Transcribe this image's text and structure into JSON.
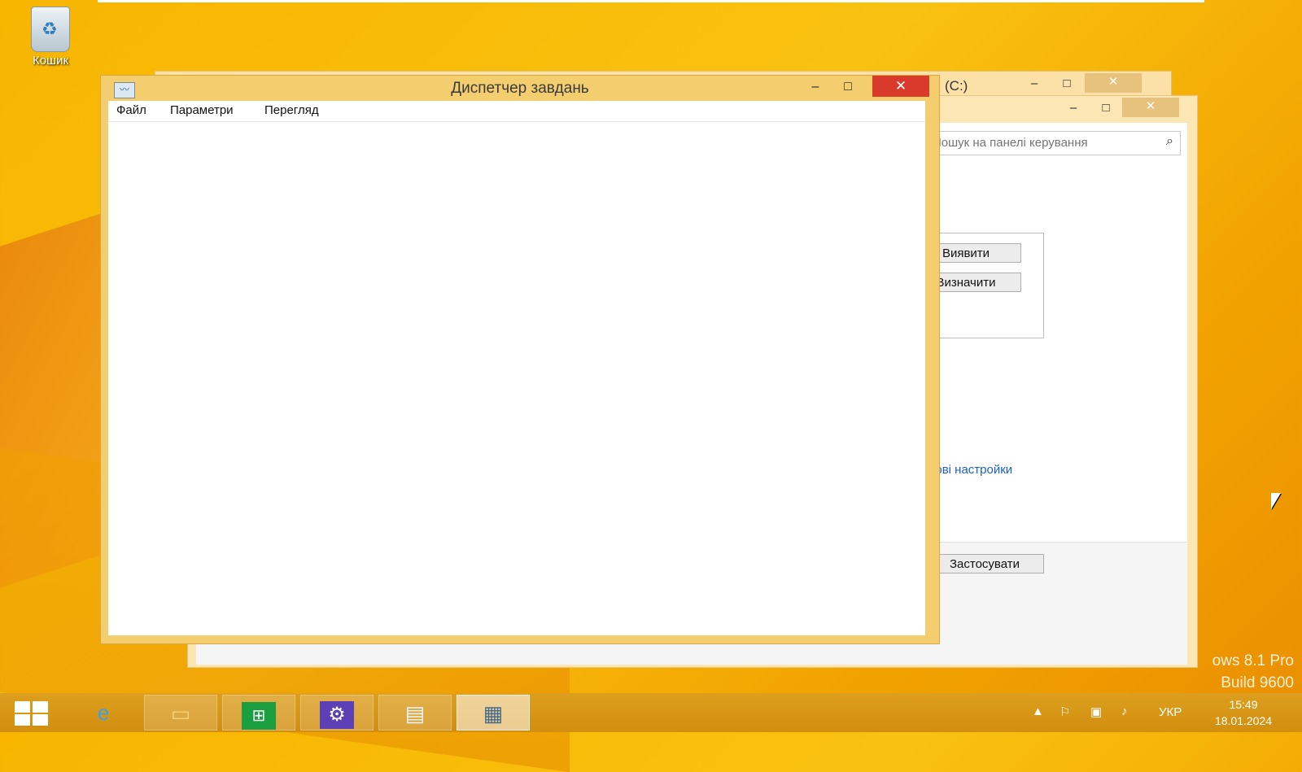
{
  "desktop": {
    "recycle_bin_label": "Кошик",
    "watermark_line1": "ows 8.1 Pro",
    "watermark_line2": "Build 9600"
  },
  "back_window_1": {
    "title": "(C:)"
  },
  "control_panel": {
    "search_placeholder": "Пошук на панелі керування",
    "detect_button": "Виявити",
    "define_button": "Визначити",
    "advanced_link": "даткові настройки",
    "apply_button": "Застосувати"
  },
  "task_manager": {
    "title": "Диспетчер завдань",
    "menu": [
      "Файл",
      "Параметри",
      "Перегляд"
    ]
  },
  "taskbar": {
    "pinned": [
      "internet-explorer",
      "file-explorer",
      "store",
      "settings",
      "control-panel",
      "task-manager"
    ],
    "language": "УКР",
    "time": "15:49",
    "date": "18.01.2024"
  }
}
